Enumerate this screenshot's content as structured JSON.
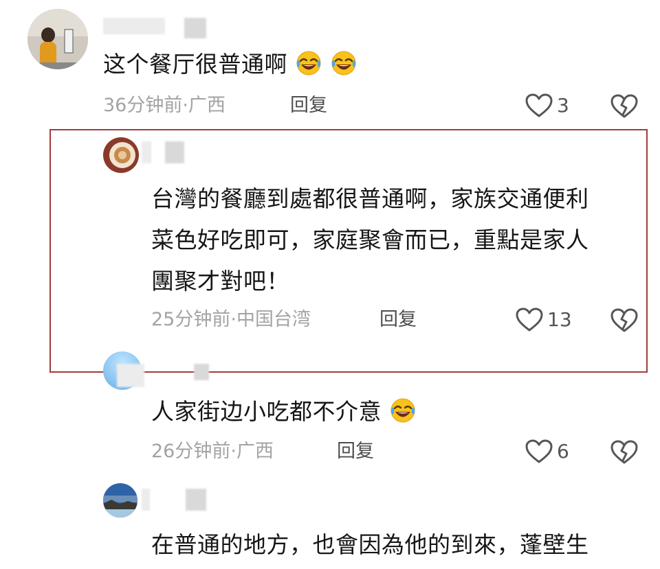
{
  "comments": [
    {
      "text": "这个餐厅很普通啊",
      "emojis": [
        "laugh-cry-emoji",
        "laugh-cry-emoji"
      ],
      "time": "36分钟前",
      "location": "广西",
      "reply_label": "回复",
      "likes": "3"
    },
    {
      "text_lines": [
        "台灣的餐廳到處都很普通啊，家族交通便利",
        "菜色好吃即可，家庭聚會而已，重點是家人",
        "團聚才對吧！"
      ],
      "time": "25分钟前",
      "location": "中国台湾",
      "reply_label": "回复",
      "likes": "13",
      "highlighted": true,
      "highlight_color": "#a33a3a"
    },
    {
      "text": "人家街边小吃都不介意",
      "emojis": [
        "laugh-cry-emoji"
      ],
      "time": "26分钟前",
      "location": "广西",
      "reply_label": "回复",
      "likes": "6"
    },
    {
      "text": "在普通的地方，也會因為他的到來，蓬壁生"
    }
  ],
  "meta_separator": "·",
  "icons": {
    "like": "heart-outline-icon",
    "dislike": "broken-heart-icon"
  }
}
